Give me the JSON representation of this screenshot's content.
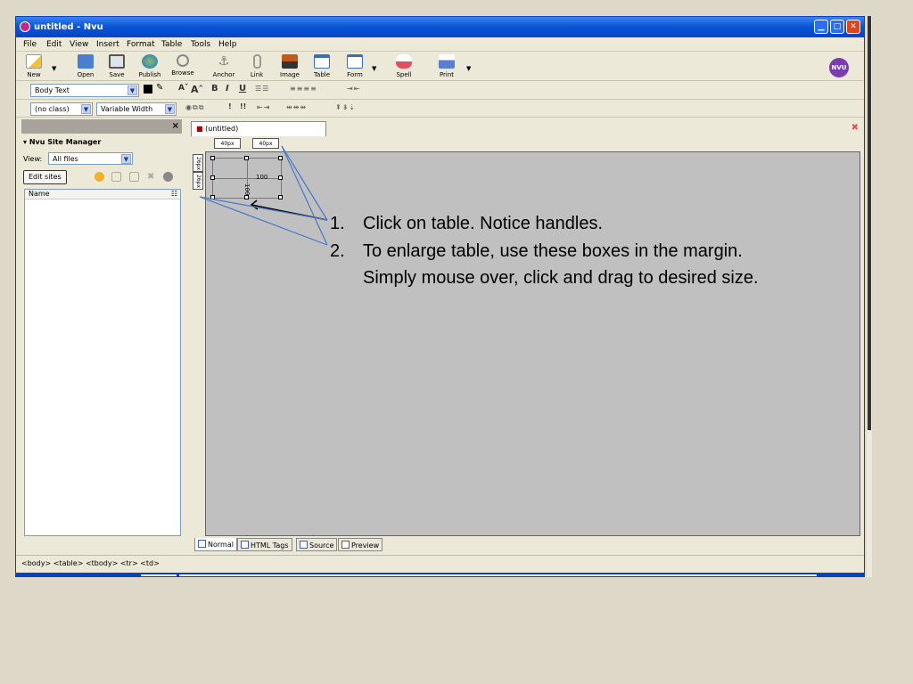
{
  "window": {
    "title": "untitled - Nvu",
    "min_glyph": "▁",
    "max_glyph": "□",
    "close_glyph": "✕"
  },
  "menu": [
    "File",
    "Edit",
    "View",
    "Insert",
    "Format",
    "Table",
    "Tools",
    "Help"
  ],
  "toolbar": {
    "buttons": [
      {
        "label": "New",
        "icon": "new-page-icon"
      },
      {
        "label": "Open",
        "icon": "open-folder-icon"
      },
      {
        "label": "Save",
        "icon": "floppy-disk-icon"
      },
      {
        "label": "Publish",
        "icon": "globe-icon"
      },
      {
        "label": "Browse",
        "icon": "magnifier-icon"
      },
      {
        "label": "Anchor",
        "icon": "anchor-icon"
      },
      {
        "label": "Link",
        "icon": "paperclip-icon"
      },
      {
        "label": "Image",
        "icon": "image-icon"
      },
      {
        "label": "Table",
        "icon": "table-icon"
      },
      {
        "label": "Form",
        "icon": "form-icon"
      },
      {
        "label": "Spell",
        "icon": "spell-check-icon"
      },
      {
        "label": "Print",
        "icon": "printer-icon"
      }
    ],
    "logo": "NVU"
  },
  "format": {
    "paragraph_style": "Body Text",
    "class_select": "(no class)",
    "width_select": "Variable Width",
    "bold": "B",
    "italic": "I",
    "underline": "U",
    "small_font": "Aˇ",
    "large_font": "Aˆ",
    "important": "!",
    "very_important": "!!"
  },
  "sidebar": {
    "title": "Nvu Site Manager",
    "view_label": "View:",
    "view_value": "All files",
    "edit_sites": "Edit sites",
    "column_name": "Name"
  },
  "editor": {
    "tab": "(untitled)",
    "ruler_top": [
      "40px",
      "40px"
    ],
    "ruler_left": [
      "26px",
      "26px"
    ],
    "cell_text": "100",
    "mode_tabs": [
      "Normal",
      "HTML Tags",
      "Source",
      "Preview"
    ]
  },
  "status_bar": "<body> <table> <tbody> <tr> <td>",
  "annotation": {
    "items": [
      {
        "num": "1.",
        "text": "Click on table. Notice handles."
      },
      {
        "num": "2.",
        "text": "To enlarge table, use these boxes in the margin."
      }
    ],
    "continuation": "Simply mouse over, click and drag to desired size.",
    "arrow_color": "#4a77c9"
  }
}
